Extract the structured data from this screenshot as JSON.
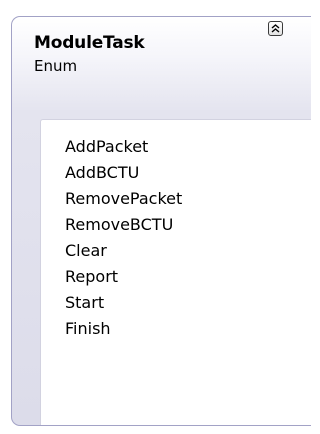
{
  "shape": {
    "title": "ModuleTask",
    "stereotype": "Enum",
    "collapse_icon": "double-chevron-up-icon",
    "members": [
      "AddPacket",
      "AddBCTU",
      "RemovePacket",
      "RemoveBCTU",
      "Clear",
      "Report",
      "Start",
      "Finish"
    ]
  },
  "colors": {
    "border": "#a2a2c6",
    "header_gradient_end": "#dcdcea",
    "member_area": "#ffffff"
  }
}
